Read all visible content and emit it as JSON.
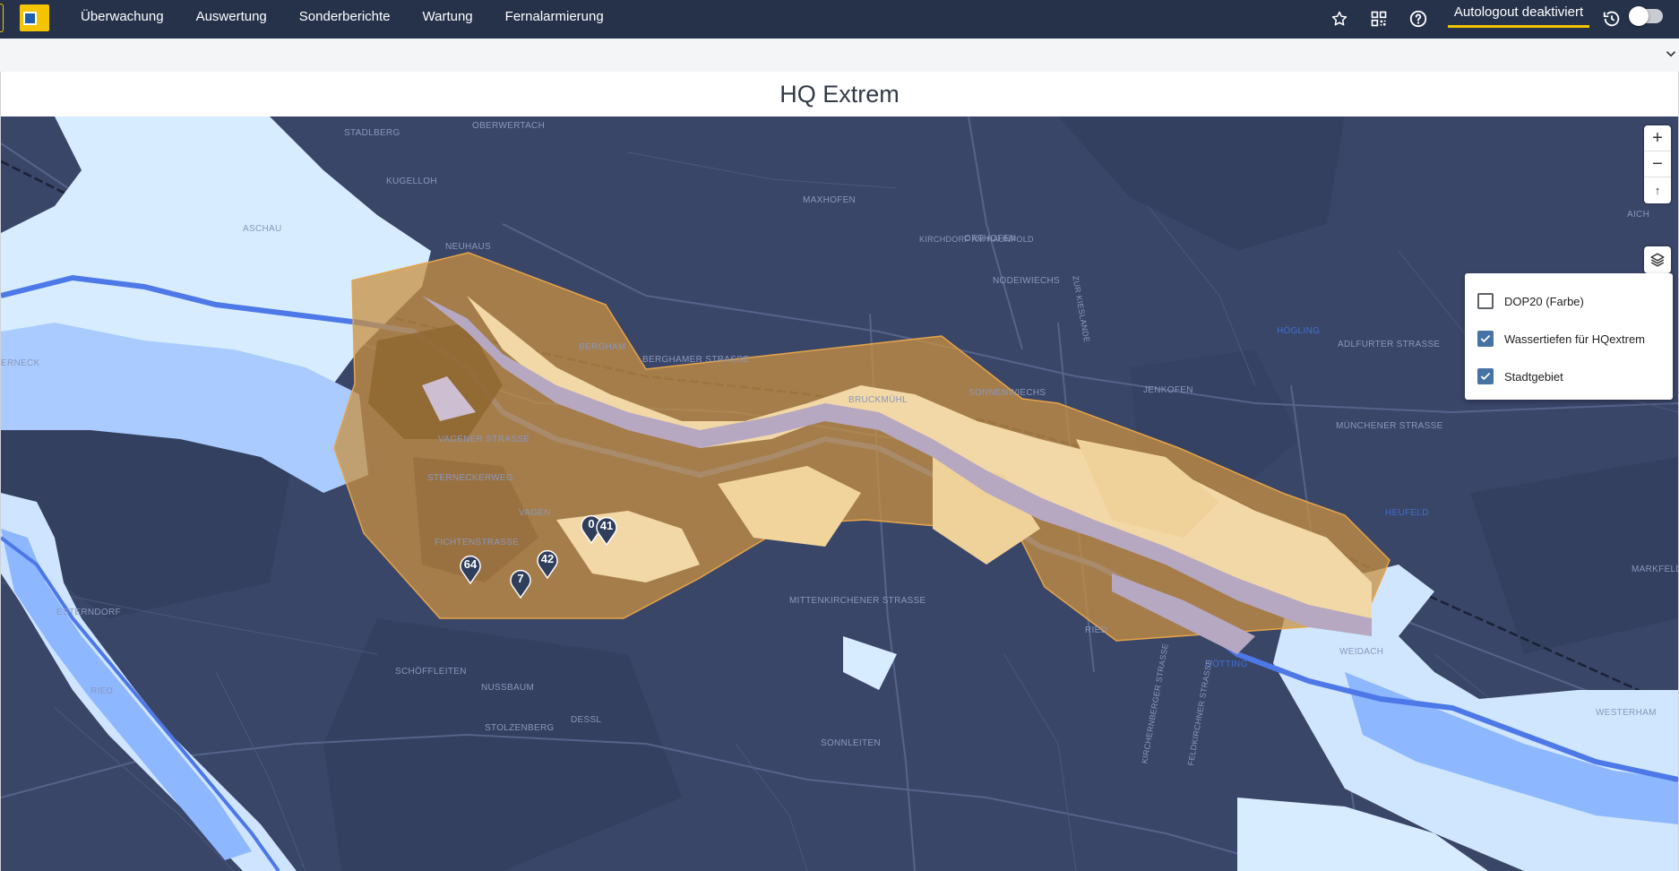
{
  "nav": {
    "items": [
      "Überwachung",
      "Auswertung",
      "Sonderberichte",
      "Wartung",
      "Fernalarmierung"
    ],
    "autologout_label": "Autologout deaktiviert",
    "icons": [
      "star-icon",
      "qr-code-icon",
      "help-icon",
      "history-icon"
    ]
  },
  "panel": {
    "title": "HQ Extrem"
  },
  "map": {
    "places": [
      "STADLBERG",
      "OBERWERTACH",
      "KUGELLOH",
      "MAXHOFEN",
      "ASCHAU",
      "NEUHAUS",
      "KIRCHDORF AM HAUNPOLD",
      "ORTHOFEN",
      "NODEIWIECHS",
      "HÖGLING",
      "ADLFURTER STRASSE",
      "BERGHAM",
      "BERGHAMER STRASSE",
      "BRUCKMÜHL",
      "SONNENWIECHS",
      "JENKOFEN",
      "MÜNCHENER STRASSE",
      "VAGENER STRASSE",
      "STERNECKERWEG",
      "VAGEN",
      "FICHTENSTRASSE",
      "HEUFELD",
      "MARKFELD",
      "MITTENKIRCHENER STRASSE",
      "RIED",
      "WEIDACH",
      "GÖTTING",
      "WESTERHAM",
      "ESTERNDORF",
      "SCHÖFFLEITEN",
      "NUSSBAUM",
      "DESSL",
      "STOLZENBERG",
      "SONNLEITEN",
      "ERNECK",
      "RIED",
      "ZUR KIESLANDE",
      "KIRCHERNBERGER STRASSE",
      "FELDKIRCHNER STRASSE",
      "AICH"
    ],
    "markers": [
      "0",
      "41",
      "42",
      "64",
      "7"
    ],
    "zoom_in": "+",
    "zoom_out": "−",
    "reset": "↑"
  },
  "layers": [
    {
      "label": "DOP20 (Farbe)",
      "checked": false
    },
    {
      "label": "Wassertiefen für HQextrem",
      "checked": true
    },
    {
      "label": "Stadtgebiet",
      "checked": true
    }
  ],
  "colors": {
    "topbar": "#25324a",
    "accent": "#f5c400",
    "map_bg": "#3a4668",
    "polygon": "#c89040",
    "water_light": "#d7ecff",
    "water_mid": "#8db7ff",
    "river": "#4d78e8"
  }
}
